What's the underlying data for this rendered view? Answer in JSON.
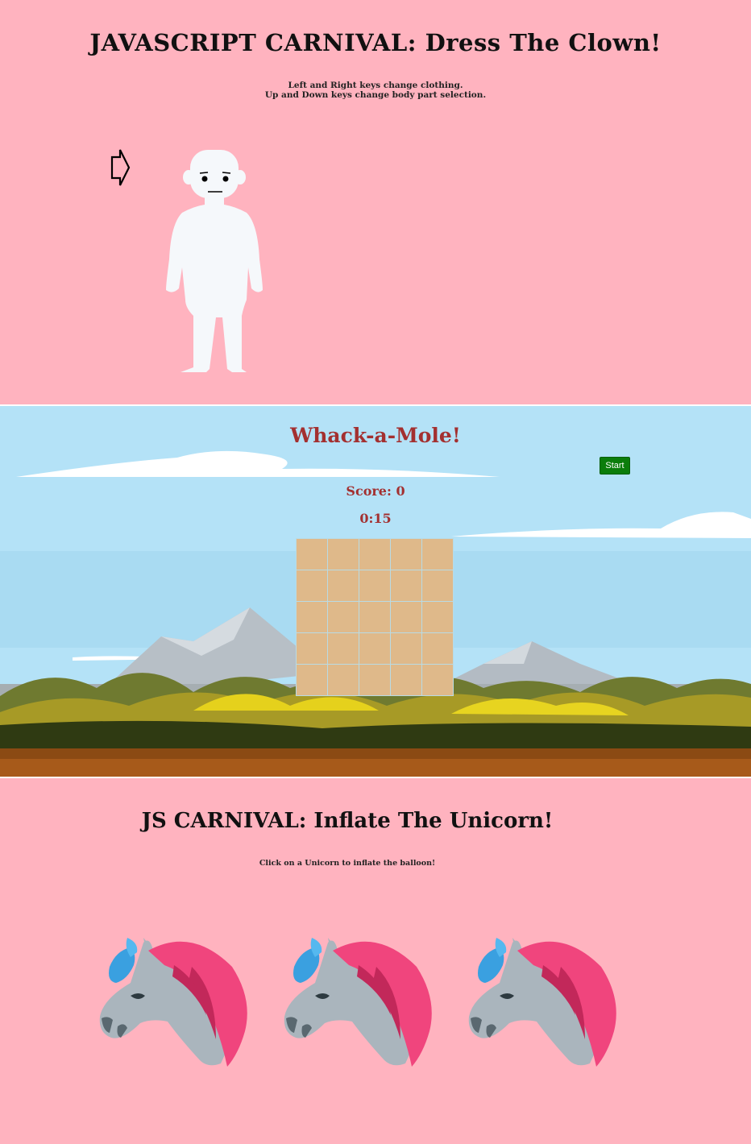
{
  "clown": {
    "title": "JAVASCRIPT CARNIVAL: Dress The Clown!",
    "instructions": [
      "Left and Right keys change clothing.",
      "Up and Down keys change body part selection."
    ]
  },
  "mole": {
    "title": "Whack-a-Mole!",
    "score": "Score: 0",
    "timer": "0:15",
    "start_label": "Start"
  },
  "unicorn": {
    "title": "JS CARNIVAL: Inflate The Unicorn!",
    "instructions": "Click on a Unicorn to inflate the balloon!"
  },
  "colors": {
    "pink_bg": "#ffb3bf",
    "sky": "#b4e2f7",
    "mole_text": "#a33030",
    "start_button": "#0b7d0b",
    "hole": "#dfb98a",
    "mane": "#f0457d",
    "balloon": "#3aa0e0"
  }
}
